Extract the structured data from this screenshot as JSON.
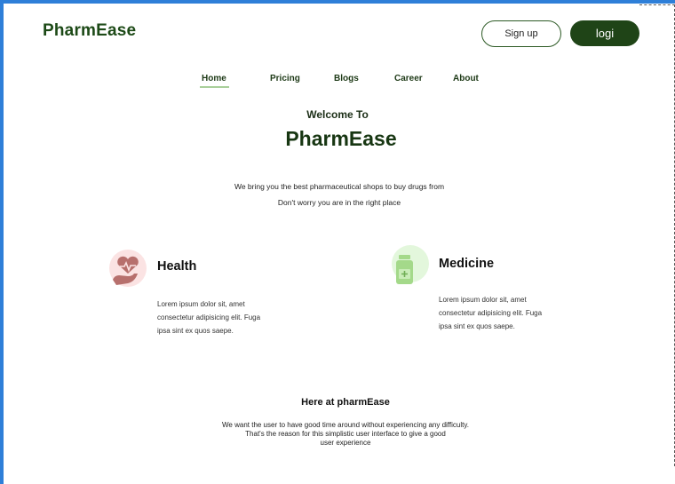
{
  "header": {
    "logo": "PharmEase",
    "signup_label": "Sign up",
    "login_label": "logi"
  },
  "nav": {
    "items": [
      "Home",
      "Pricing",
      "Blogs",
      "Career",
      "About"
    ],
    "active": "Home"
  },
  "hero": {
    "welcome": "Welcome To",
    "title": "PharmEase",
    "tagline_line1": "We bring you the best pharmaceutical shops to buy drugs from",
    "tagline_line2": "Don't worry you are in the right place"
  },
  "features": [
    {
      "icon": "heart-hand-icon",
      "title": "Health",
      "desc_line1": "Lorem ipsum dolor sit, amet",
      "desc_line2": "consectetur adipisicing elit. Fuga",
      "desc_line3": "ipsa sint ex quos saepe."
    },
    {
      "icon": "medicine-bottle-icon",
      "title": "Medicine",
      "desc_line1": "Lorem ipsum dolor sit, amet",
      "desc_line2": "consectetur adipisicing elit. Fuga",
      "desc_line3": "ipsa sint ex quos saepe."
    }
  ],
  "about": {
    "title": "Here at pharmEase",
    "line1": "We want the user to have good time around without experiencing any difficulty.",
    "line2": "That's the reason for this simplistic user interface to give a good",
    "line3": "user experience"
  },
  "colors": {
    "brand_dark": "#1f4417",
    "nav_underline": "#a9cf9a",
    "health_bg": "#fbe3e3",
    "health_icon": "#b7706d",
    "medicine_bg": "#e3f7dc",
    "medicine_icon": "#a4d98a",
    "frame_border": "#2e7fd8"
  }
}
